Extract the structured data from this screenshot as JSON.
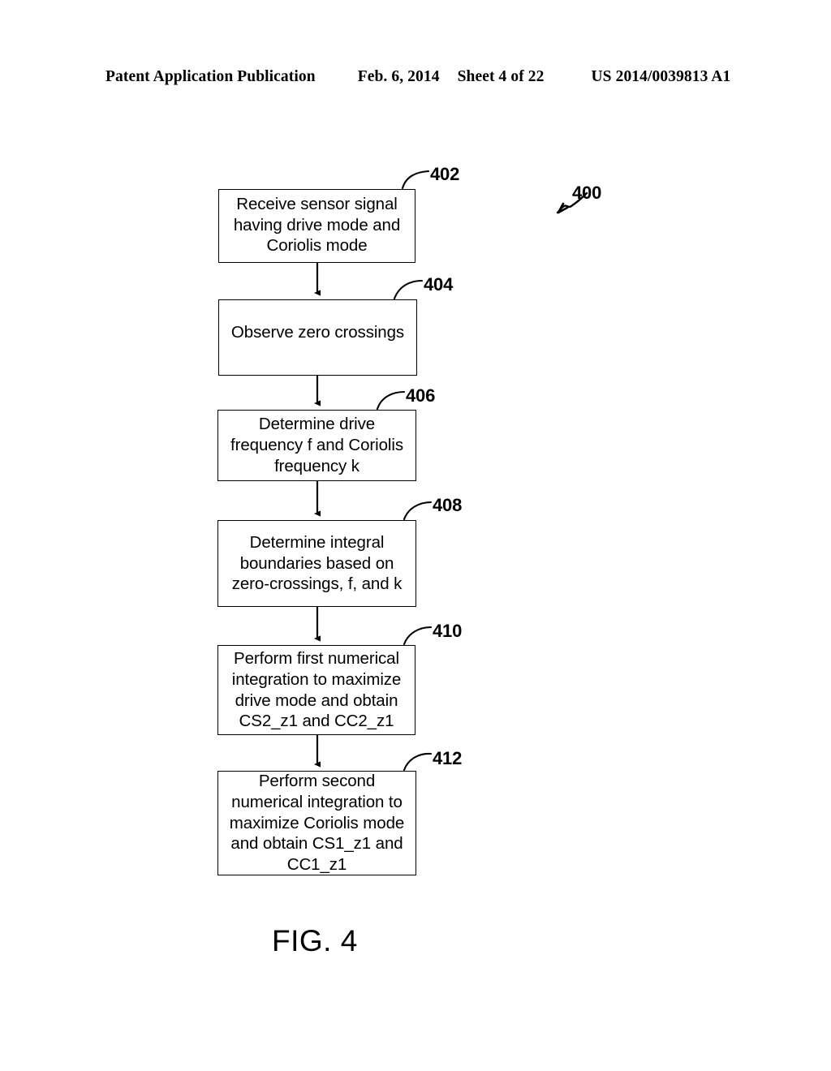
{
  "header": {
    "publication": "Patent Application Publication",
    "date": "Feb. 6, 2014",
    "sheet": "Sheet 4 of 22",
    "patent_number": "US 2014/0039813 A1"
  },
  "figure": {
    "caption": "FIG. 4",
    "diagram_reference": "400",
    "nodes": [
      {
        "ref": "402",
        "text": "Receive sensor signal having drive mode and Coriolis mode"
      },
      {
        "ref": "404",
        "text": "Observe zero crossings"
      },
      {
        "ref": "406",
        "text": "Determine drive frequency f and Coriolis frequency k"
      },
      {
        "ref": "408",
        "text": "Determine integral boundaries based on zero-crossings, f, and k"
      },
      {
        "ref": "410",
        "text": "Perform first numerical integration to maximize drive mode and obtain CS2_z1 and CC2_z1"
      },
      {
        "ref": "412",
        "text": "Perform second numerical integration to maximize Coriolis mode and obtain CS1_z1 and CC1_z1"
      }
    ]
  },
  "colors": {
    "ink": "#000000",
    "page": "#ffffff"
  }
}
